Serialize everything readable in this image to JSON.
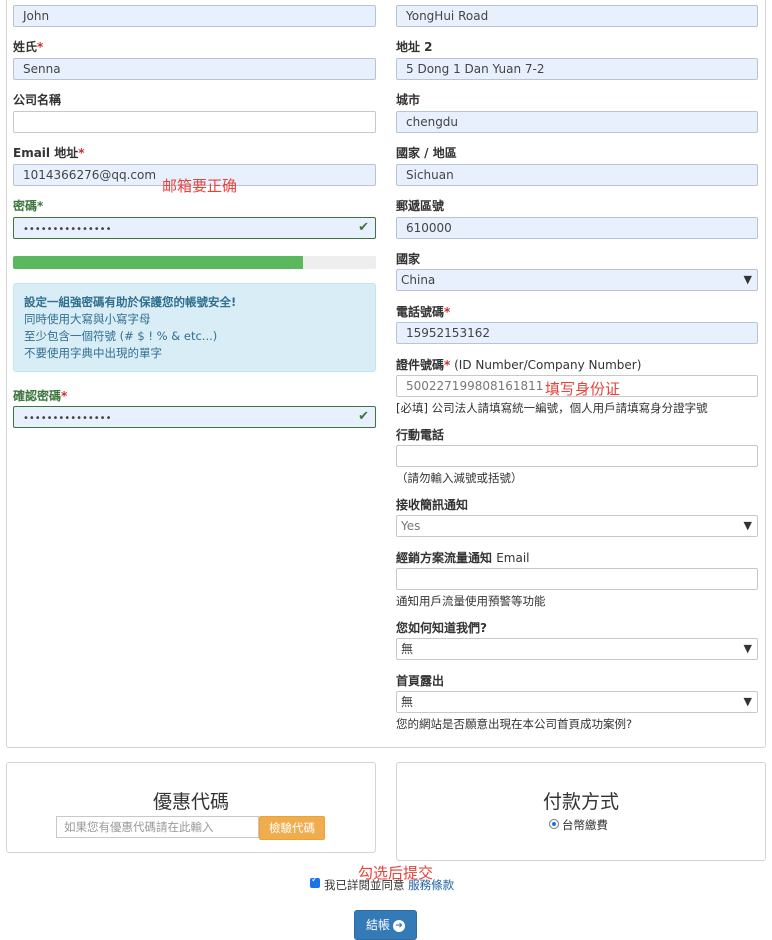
{
  "left": {
    "first_name_value": "John",
    "last_name": {
      "label": "姓氏",
      "required": "*",
      "value": "Senna"
    },
    "company": {
      "label": "公司名稱",
      "value": ""
    },
    "email": {
      "label_a": "Email ",
      "label_b": "地址",
      "required": "*",
      "value": "1014366276@qq.com"
    },
    "password": {
      "label": "密碼",
      "required": "*",
      "value": "•••••••••••••••",
      "check_icon": "check-icon"
    },
    "strength_percent": 80,
    "tip": {
      "title": "設定一組強密碼有助於保護您的帳號安全!",
      "lines": [
        "同時使用大寫與小寫字母",
        "至少包含一個符號 (# $ ! % & etc...)",
        "不要使用字典中出現的單字"
      ]
    },
    "confirm_password": {
      "label": "確認密碼",
      "required": "*",
      "value": "•••••••••••••••"
    }
  },
  "right": {
    "address1_value": "YongHui Road",
    "address2": {
      "label": "地址 2",
      "value": "5 Dong 1 Dan Yuan 7-2"
    },
    "city": {
      "label": "城市",
      "value": "chengdu"
    },
    "region": {
      "label": "國家 / 地區",
      "value": "Sichuan"
    },
    "postcode": {
      "label": "郵遞區號",
      "value": "610000"
    },
    "country": {
      "label": "國家",
      "value": "China"
    },
    "phone": {
      "label": "電話號碼",
      "required": "*",
      "value": "15952153162"
    },
    "id_number": {
      "label": "證件號碼",
      "required": "*",
      "label_extra": " (ID Number/Company Number)",
      "value": "500227199808161811",
      "help": "[必填] 公司法人請填寫統一編號，個人用戶請填寫身分證字號"
    },
    "mobile": {
      "label": "行動電話",
      "value": "",
      "help": "（請勿輸入減號或括號）"
    },
    "sms": {
      "label": "接收簡訊通知",
      "value": "Yes"
    },
    "reseller_email": {
      "label_a": "經銷方案流量通知 ",
      "label_b": "Email",
      "value": "",
      "help": "通知用戶流量使用預警等功能"
    },
    "referral": {
      "label": "您如何知道我們?",
      "value": "無"
    },
    "homepage": {
      "label": "首頁露出",
      "value": "無",
      "help": "您的網站是否願意出現在本公司首頁成功案例?"
    }
  },
  "annotations": {
    "email_note": "邮箱要正确",
    "id_note": "填写身份证",
    "submit_note": "勾选后提交"
  },
  "coupon": {
    "title": "優惠代碼",
    "placeholder": "如果您有優惠代碼請在此輸入",
    "button": "檢驗代碼"
  },
  "payment": {
    "title": "付款方式",
    "option": "台幣繳費"
  },
  "terms": {
    "text": "我已詳閱並同意 ",
    "link": "服務條款"
  },
  "submit": {
    "label": "結帳",
    "icon": "arrow-right-circle-icon"
  },
  "colors": {
    "accent_blue": "#337ab7",
    "success_green": "#5cb85c",
    "warning_orange": "#f0ad4e",
    "annotation_red": "#e8423b",
    "autofill_bg": "#e8f0fe"
  }
}
